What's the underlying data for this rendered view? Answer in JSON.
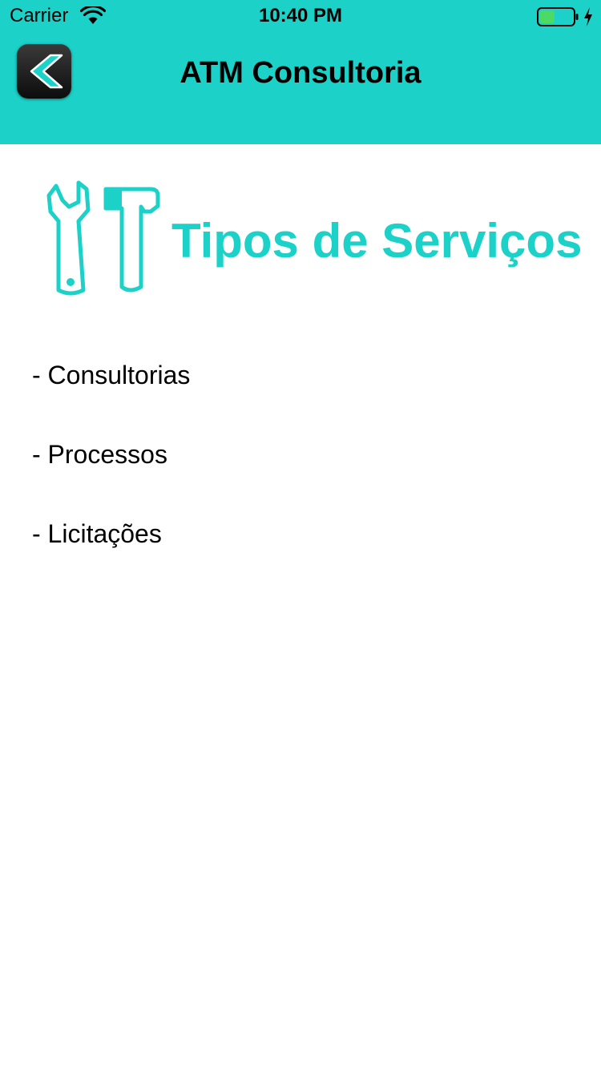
{
  "status_bar": {
    "carrier": "Carrier",
    "time": "10:40 PM",
    "wifi_icon": "wifi-icon",
    "battery_icon": "battery-charging-icon",
    "battery_color": "#4cd964"
  },
  "nav": {
    "title": "ATM Consultoria",
    "back_icon": "chevron-left-icon"
  },
  "content": {
    "section_icon": "wrench-hammer-icon",
    "section_title": "Tipos de Serviços",
    "services": [
      "- Consultorias",
      "- Processos",
      "- Licitações"
    ]
  },
  "colors": {
    "accent": "#1bd1c8",
    "background": "#ffffff",
    "text": "#000000"
  }
}
